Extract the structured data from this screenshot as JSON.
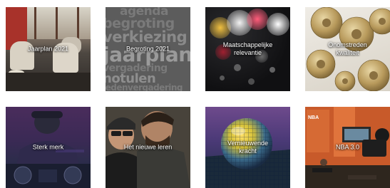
{
  "tiles": [
    {
      "label": "Jaarplan 2021"
    },
    {
      "label": "Begroting 2021"
    },
    {
      "label": "Maatschappelijke\nrelevantie"
    },
    {
      "label": "Onomstreden\nkwaliteit"
    },
    {
      "label": "Sterk merk"
    },
    {
      "label": "Het nieuwe leren"
    },
    {
      "label": "Vernieuwende\nkracht"
    },
    {
      "label": "NBA 3.0"
    }
  ],
  "wordcloud": {
    "words": [
      "agenda",
      "begroting",
      "verkiezing",
      "jaarplan",
      "vergadering",
      "notulen",
      "ledenvergadering"
    ]
  },
  "nba_slide_text": "NBA"
}
